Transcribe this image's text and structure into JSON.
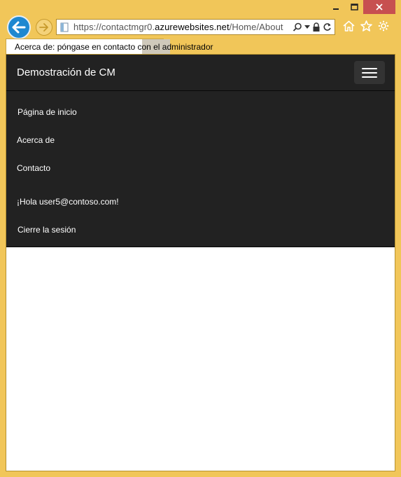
{
  "browser": {
    "window_controls": {
      "minimize": "–",
      "maximize": "☐",
      "close": "✕"
    },
    "address": {
      "scheme": "https://contactmgr0.",
      "host": "azurewebsites.net",
      "path": "/Home/About"
    },
    "tab": {
      "title": "Acerca de: póngase en contacto con el administrador"
    },
    "icons": {
      "back": "back-arrow-icon",
      "forward": "forward-arrow-icon",
      "home": "home-icon",
      "favorites": "star-icon",
      "tools": "gear-icon"
    }
  },
  "page": {
    "brand": "Demostración de CM",
    "nav_items": [
      {
        "label": "Página de inicio"
      },
      {
        "label": "Acerca de"
      },
      {
        "label": "Contacto"
      }
    ],
    "account_items": [
      {
        "label": "¡Hola user5@contoso.com!"
      },
      {
        "label": "Cierre la sesión"
      }
    ],
    "colors": {
      "navbar": "#222222",
      "frame": "#f1c659",
      "back_button": "#1e88d0"
    }
  }
}
